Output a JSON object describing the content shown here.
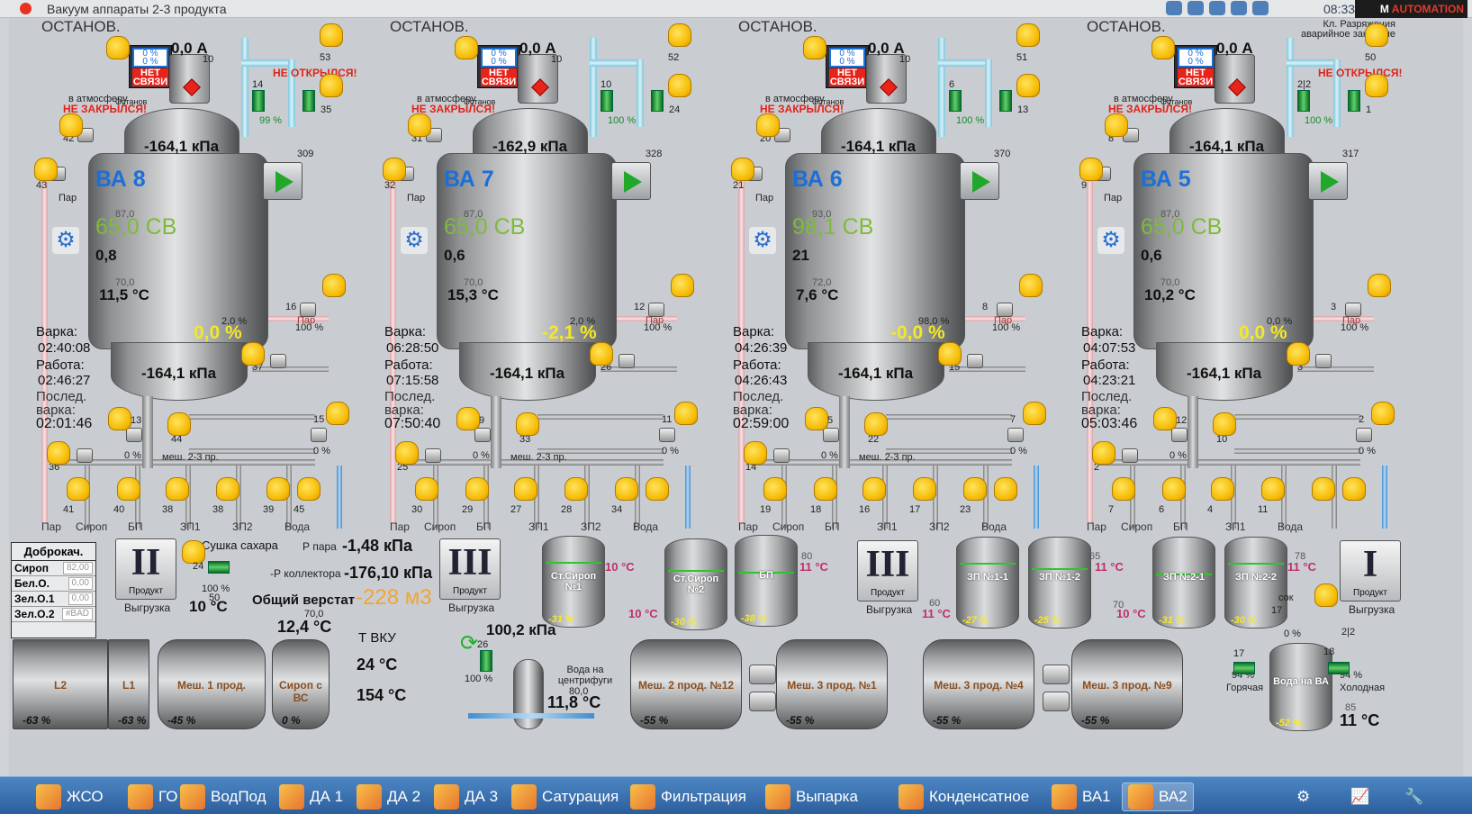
{
  "window": {
    "title": "Вакуум аппараты 2-3 продукта",
    "clock": "08:33:10",
    "brand": "AUTOMATION",
    "note": "Кл. Разряжения аварийное закрытие"
  },
  "units": [
    {
      "status": "ОСТАНОВ.",
      "current": "0,0 А",
      "display_top": "0 %",
      "display_mid": "0 %",
      "no_link": "НЕТ СВЯЗИ",
      "top_pressure": "-164,1 кПа",
      "name": "ВА 8",
      "cv": "65,0 СВ",
      "small_value": "0,8",
      "temp": "11,5 °C",
      "sp_cv": "87,0",
      "sp_temp": "70,0",
      "level": "0,0 %",
      "level_sp": "2,0 %",
      "bottom_pressure": "-164,1 кПа",
      "cook_label": "Варка:",
      "cook_time": "02:40:08",
      "work_label": "Работа:",
      "work_time": "02:46:27",
      "last_label": "Послед. варка:",
      "last_time": "02:01:46",
      "id_a": "309",
      "atm_label": "в атмосферу",
      "stop_tag": "Останов",
      "warn1": "НЕ ЗАКРЫЛСЯ!",
      "warn2": "НЕ ОТКРЫЛСЯ!",
      "v_42": "42",
      "v_43": "43",
      "v_13": "13",
      "v_44": "44",
      "v_15": "15",
      "v_36": "36",
      "v_41": "41",
      "v_40": "40",
      "v_38": "38",
      "v_38b": "38",
      "v_39": "39",
      "v_45": "45",
      "v_16": "16",
      "v_37": "37",
      "v_35": "35",
      "v_53": "53",
      "v_14": "14",
      "v_10": "10",
      "pct_valve": "99 %",
      "pct_16": "100 %",
      "pct_13": "0 %",
      "pct_15": "0 %",
      "mix": "меш. 2-3 пр.",
      "steam": "Пар",
      "lines": [
        "Пар",
        "Сироп",
        "БП",
        "ЗП1",
        "ЗП2",
        "Вода"
      ]
    },
    {
      "status": "ОСТАНОВ.",
      "current": "0,0 А",
      "display_top": "0 %",
      "display_mid": "0 %",
      "no_link": "НЕТ СВЯЗИ",
      "top_pressure": "-162,9 кПа",
      "name": "ВА 7",
      "cv": "65,0 СВ",
      "small_value": "0,6",
      "temp": "15,3 °C",
      "sp_cv": "87,0",
      "sp_temp": "70,0",
      "level": "-2,1 %",
      "level_sp": "2,0 %",
      "bottom_pressure": "-164,1 кПа",
      "cook_label": "Варка:",
      "cook_time": "06:28:50",
      "work_label": "Работа:",
      "work_time": "07:15:58",
      "last_label": "Послед. варка:",
      "last_time": "07:50:40",
      "id_a": "328",
      "atm_label": "в атмосферу",
      "stop_tag": "Останов",
      "warn1": "НЕ ЗАКРЫЛСЯ!",
      "warn2": "",
      "v_42": "31",
      "v_43": "32",
      "v_13": "9",
      "v_44": "33",
      "v_15": "11",
      "v_36": "25",
      "v_41": "30",
      "v_40": "29",
      "v_38": "27",
      "v_38b": "28",
      "v_39": "34",
      "v_45": "",
      "v_16": "12",
      "v_37": "26",
      "v_35": "24",
      "v_53": "52",
      "v_14": "10",
      "v_10": "10",
      "pct_valve": "100 %",
      "pct_16": "100 %",
      "pct_13": "0 %",
      "pct_15": "0 %",
      "mix": "меш. 2-3 пр.",
      "steam": "Пар",
      "lines": [
        "Пар",
        "Сироп",
        "БП",
        "ЗП1",
        "ЗП2",
        "Вода"
      ]
    },
    {
      "status": "ОСТАНОВ.",
      "current": "0,0 А",
      "display_top": "0 %",
      "display_mid": "0 %",
      "no_link": "НЕТ СВЯЗИ",
      "top_pressure": "-164,1 кПа",
      "name": "ВА 6",
      "cv": "98,1 СВ",
      "small_value": "21",
      "temp": "7,6 °C",
      "sp_cv": "93,0",
      "sp_temp": "72,0",
      "level": "-0,0 %",
      "level_sp": "98,0 %",
      "bottom_pressure": "-164,1 кПа",
      "cook_label": "Варка:",
      "cook_time": "04:26:39",
      "work_label": "Работа:",
      "work_time": "04:26:43",
      "last_label": "Послед. варка:",
      "last_time": "02:59:00",
      "id_a": "370",
      "atm_label": "в атмосферу",
      "stop_tag": "Останов",
      "warn1": "НЕ ЗАКРЫЛСЯ!",
      "warn2": "",
      "v_42": "20",
      "v_43": "21",
      "v_13": "5",
      "v_44": "22",
      "v_15": "7",
      "v_36": "14",
      "v_41": "19",
      "v_40": "18",
      "v_38": "16",
      "v_38b": "17",
      "v_39": "23",
      "v_45": "",
      "v_16": "8",
      "v_37": "15",
      "v_35": "13",
      "v_53": "51",
      "v_14": "6",
      "v_10": "10",
      "pct_valve": "100 %",
      "pct_16": "100 %",
      "pct_13": "0 %",
      "pct_15": "0 %",
      "mix": "меш. 2-3 пр.",
      "steam": "Пар",
      "lines": [
        "Пар",
        "Сироп",
        "БП",
        "ЗП1",
        "ЗП2",
        "Вода"
      ]
    },
    {
      "status": "ОСТАНОВ.",
      "current": "0,0 А",
      "display_top": "0 %",
      "display_mid": "0 %",
      "no_link": "НЕТ СВЯЗИ",
      "top_pressure": "-164,1 кПа",
      "name": "ВА 5",
      "cv": "65,0 СВ",
      "small_value": "0,6",
      "temp": "10,2 °C",
      "sp_cv": "87,0",
      "sp_temp": "70,0",
      "level": "0,0 %",
      "level_sp": "0,0 %",
      "bottom_pressure": "-164,1 кПа",
      "cook_label": "Варка:",
      "cook_time": "04:07:53",
      "work_label": "Работа:",
      "work_time": "04:23:21",
      "last_label": "Послед. варка:",
      "last_time": "05:03:46",
      "id_a": "317",
      "atm_label": "в атмосферу",
      "stop_tag": "Останов",
      "warn1": "НЕ ЗАКРЫЛСЯ!",
      "warn2": "НЕ ОТКРЫЛСЯ!",
      "v_42": "8",
      "v_43": "9",
      "v_13": "12",
      "v_44": "10",
      "v_15": "2",
      "v_36": "2",
      "v_41": "7",
      "v_40": "6",
      "v_38": "4",
      "v_38b": "11",
      "v_39": "",
      "v_45": "",
      "v_16": "3",
      "v_37": "3",
      "v_35": "1",
      "v_53": "50",
      "v_14": "2|2",
      "v_10": "",
      "pct_valve": "100 %",
      "pct_16": "100 %",
      "pct_13": "0 %",
      "pct_15": "0 %",
      "mix": "",
      "steam": "Пар",
      "lines": [
        "Пар",
        "Сироп",
        "БП",
        "ЗП1",
        "Вода"
      ]
    }
  ],
  "bottom": {
    "dobrokach": {
      "title": "Доброкач.",
      "rows": [
        {
          "k": "Сироп",
          "v": "82,00"
        },
        {
          "k": "Бел.О.",
          "v": "0,00"
        },
        {
          "k": "Зел.О.1",
          "v": "0,00"
        },
        {
          "k": "Зел.О.2",
          "v": "#BAD"
        }
      ]
    },
    "btn_II": {
      "roman": "II",
      "label": "Продукт",
      "caption": "Выгрузка"
    },
    "btn_III_a": {
      "roman": "III",
      "label": "Продукт",
      "caption": "Выгрузка"
    },
    "btn_III_b": {
      "roman": "III",
      "label": "Продукт",
      "caption": "Выгрузка"
    },
    "btn_I": {
      "roman": "I",
      "label": "Продукт",
      "caption": "Выгрузка"
    },
    "dryer": {
      "label": "Сушка сахара",
      "valve": "24",
      "pct": "100 %",
      "sp": "50",
      "temp": "10 °C"
    },
    "p_steam_label": "Р пара",
    "p_steam": "-1,48 кПа",
    "p_coll_label": "-Р коллектора",
    "p_coll": "-176,10 кПа",
    "total_label": "Общий верстат",
    "total": "-228 м3",
    "tvku_label": "Т ВКУ",
    "tvku1": "24 °C",
    "tvku2": "154 °C",
    "centrifuge": {
      "pressure": "100,2 кПа",
      "valve": "26",
      "pct": "100 %",
      "label": "Вода на центрифуги",
      "sp": "80,0",
      "temp": "11,8 °C"
    },
    "sirup_temp_sp": "70,0",
    "sirup_temp": "12,4 °C",
    "tanks": [
      {
        "name": "Ст.Сироп №1",
        "level": "-31 %",
        "temp": "10 °C"
      },
      {
        "name": "Ст.Сироп №2",
        "level": "-30 %",
        "temp": "10 °C"
      },
      {
        "name": "БП",
        "level": "-38 %",
        "temp": "11 °C",
        "sp": "80"
      },
      {
        "name": "ЗП №1-1",
        "level": "-27 %",
        "temp": "11 °C",
        "sp": "60"
      },
      {
        "name": "ЗП №1-2",
        "level": "-25 %",
        "temp": "11 °C",
        "sp": "65"
      },
      {
        "name": "ЗП №2-1",
        "level": "-31 %",
        "temp": "10 °C",
        "sp": "70"
      },
      {
        "name": "ЗП №2-2",
        "level": "-30 %",
        "temp": "11 °C",
        "sp": "78"
      }
    ],
    "htanks": [
      {
        "name": "L2",
        "level": "-63 %"
      },
      {
        "name": "L1",
        "level": "-63 %"
      },
      {
        "name": "Меш. 1 прод.",
        "level": "-45 %"
      },
      {
        "name": "Сироп с ВС",
        "level": "0 %"
      },
      {
        "name": "Меш. 2 прод. №12",
        "level": "-55 %"
      },
      {
        "name": "Меш. 3 прод. №1",
        "level": "-55 %"
      },
      {
        "name": "Меш. 3 прод. №4",
        "level": "-55 %"
      },
      {
        "name": "Меш. 3 прод. №9",
        "level": "-55 %"
      }
    ],
    "water_va": {
      "name": "Вода на ВА",
      "level": "-52 %",
      "temp": "11 °C",
      "sp": "85",
      "hot": "Горячая",
      "cold": "Холодная",
      "hot_pct": "94 %",
      "cold_pct": "94 %",
      "v17": "17",
      "v18": "18",
      "v22": "2|2",
      "sok": "сок",
      "pct0": "0 %"
    }
  },
  "taskbar": [
    {
      "label": "ЖСО"
    },
    {
      "label": "ГО"
    },
    {
      "label": "ВодПод"
    },
    {
      "label": "ДА 1"
    },
    {
      "label": "ДА 2"
    },
    {
      "label": "ДА 3"
    },
    {
      "label": "Сатурация"
    },
    {
      "label": "Фильтрация"
    },
    {
      "label": "Выпарка"
    },
    {
      "label": "Конденсатное"
    },
    {
      "label": "ВА1"
    },
    {
      "label": "ВА2"
    }
  ]
}
